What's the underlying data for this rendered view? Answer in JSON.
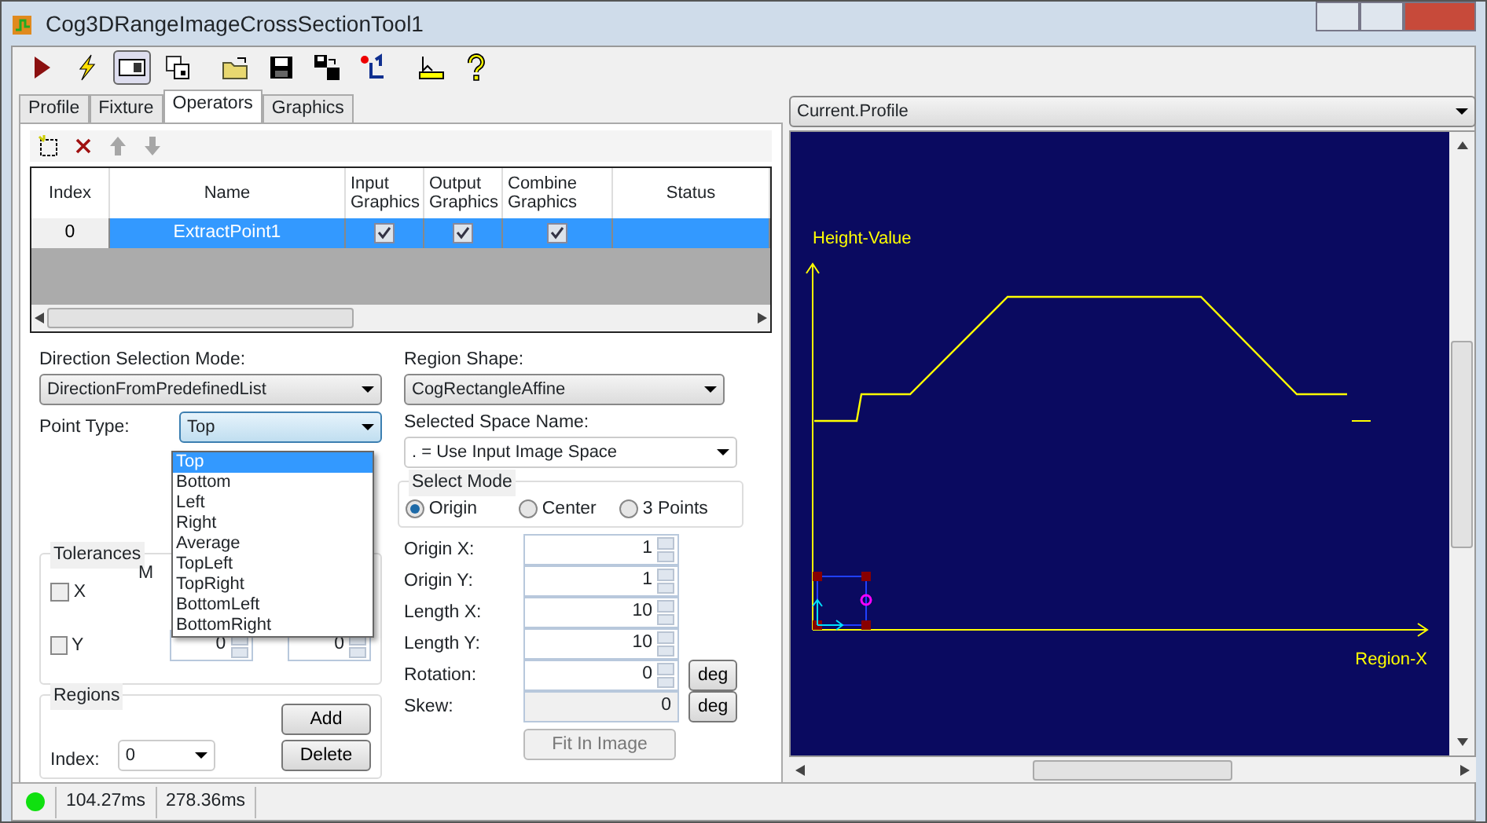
{
  "window": {
    "title": "Cog3DRangeImageCrossSectionTool1"
  },
  "toolbar": [
    {
      "kind": "run",
      "pressed": false
    },
    {
      "kind": "electric",
      "pressed": false
    },
    {
      "kind": "panel",
      "pressed": true
    },
    {
      "kind": "windows",
      "pressed": false
    },
    {
      "kind": "open",
      "pressed": false
    },
    {
      "kind": "save",
      "pressed": false
    },
    {
      "kind": "saveas",
      "pressed": false
    },
    {
      "kind": "reset",
      "pressed": false
    },
    {
      "kind": "measure",
      "pressed": false
    },
    {
      "kind": "help",
      "pressed": false
    }
  ],
  "tabs": [
    {
      "label": "Profile",
      "selected": false
    },
    {
      "label": "Fixture",
      "selected": false
    },
    {
      "label": "Operators",
      "selected": true
    },
    {
      "label": "Graphics",
      "selected": false
    }
  ],
  "operators_toolbar": [
    {
      "kind": "add",
      "disabled": false
    },
    {
      "kind": "delete",
      "disabled": false
    },
    {
      "kind": "up",
      "disabled": true
    },
    {
      "kind": "down",
      "disabled": true
    }
  ],
  "table": {
    "columns": [
      "Index",
      "Name",
      "Input Graphics",
      "Output Graphics",
      "Combine Graphics",
      "Status"
    ],
    "rows": [
      {
        "index": "0",
        "name": "ExtractPoint1",
        "input_graphics": true,
        "output_graphics": true,
        "combine_graphics": true,
        "selected": true
      }
    ]
  },
  "direction_selection": {
    "label": "Direction Selection Mode:",
    "value": "DirectionFromPredefinedList"
  },
  "point_type": {
    "label": "Point Type:",
    "value": "Top",
    "expanded": true,
    "options": [
      {
        "label": "Top",
        "selected": true
      },
      {
        "label": "Bottom",
        "selected": false
      },
      {
        "label": "Left",
        "selected": false
      },
      {
        "label": "Right",
        "selected": false
      },
      {
        "label": "Average",
        "selected": false
      },
      {
        "label": "TopLeft",
        "selected": false
      },
      {
        "label": "TopRight",
        "selected": false
      },
      {
        "label": "BottomLeft",
        "selected": false
      },
      {
        "label": "BottomRight",
        "selected": false
      }
    ]
  },
  "tolerances": {
    "title": "Tolerances",
    "column_label": "M",
    "checks": [
      {
        "label": "X",
        "checked": false
      },
      {
        "label": "Y",
        "checked": false
      }
    ],
    "values": [
      "0",
      "0"
    ]
  },
  "regions": {
    "title": "Regions",
    "add": "Add",
    "delete": "Delete",
    "index_label": "Index:",
    "index_value": "0"
  },
  "region_shape": {
    "label": "Region Shape:",
    "value": "CogRectangleAffine"
  },
  "selected_space": {
    "label": "Selected Space Name:",
    "value": ". = Use Input Image Space"
  },
  "select_mode": {
    "title": "Select Mode",
    "options": [
      {
        "label": "Origin",
        "selected": true
      },
      {
        "label": "Center",
        "selected": false
      },
      {
        "label": "3 Points",
        "selected": false
      }
    ]
  },
  "fields": [
    {
      "label": "Origin X:",
      "value": "1",
      "kind": "spin"
    },
    {
      "label": "Origin Y:",
      "value": "1",
      "kind": "spin"
    },
    {
      "label": "Length X:",
      "value": "10",
      "kind": "spin"
    },
    {
      "label": "Length Y:",
      "value": "10",
      "kind": "spin"
    },
    {
      "label": "Rotation:",
      "value": "0",
      "kind": "spin",
      "unit": "deg"
    },
    {
      "label": "Skew:",
      "value": "0",
      "kind": "readonly",
      "unit": "deg"
    }
  ],
  "fit_button": {
    "label": "Fit In Image",
    "disabled": true
  },
  "display": {
    "selector": "Current.Profile",
    "y_axis_label": "Height-Value",
    "x_axis_label": "Region-X"
  },
  "status_bar": {
    "ok": true,
    "times": [
      "104.27ms",
      "278.36ms"
    ]
  }
}
